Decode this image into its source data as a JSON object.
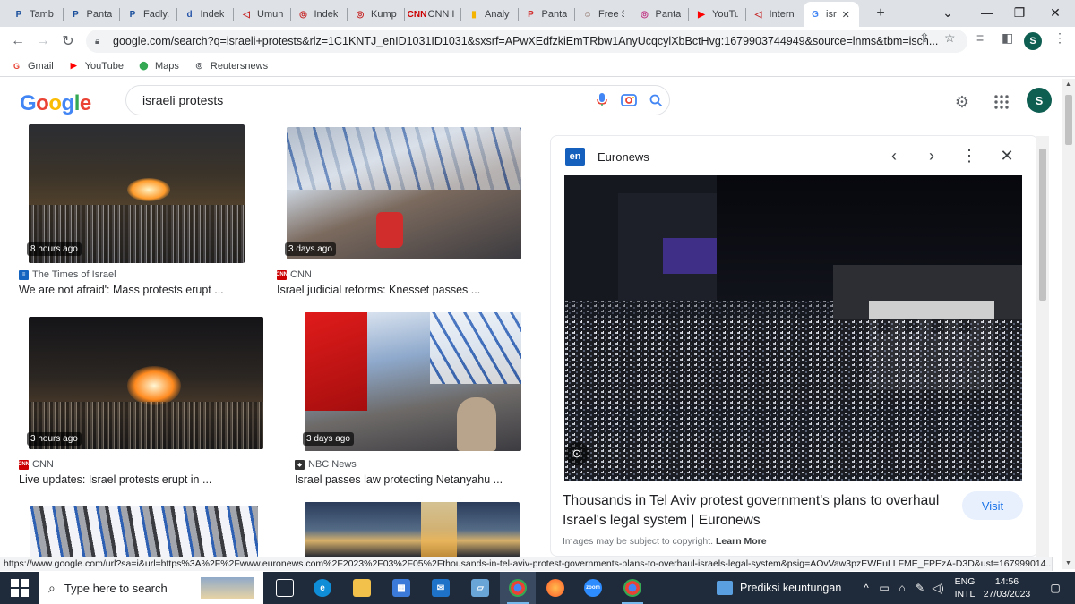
{
  "tabs": [
    {
      "label": "Tamb",
      "icon": "P",
      "color": "#1a4f9c"
    },
    {
      "label": "Panta",
      "icon": "P",
      "color": "#1a4f9c"
    },
    {
      "label": "Fadly.",
      "icon": "P",
      "color": "#1a4f9c"
    },
    {
      "label": "Indek",
      "icon": "d",
      "color": "#2453a8"
    },
    {
      "label": "Umun",
      "icon": "◁",
      "color": "#c62828"
    },
    {
      "label": "Indek",
      "icon": "◎",
      "color": "#c62828"
    },
    {
      "label": "Kump",
      "icon": "◎",
      "color": "#c62828"
    },
    {
      "label": "CNN I",
      "icon": "CNN",
      "color": "#cc0000"
    },
    {
      "label": "Analy",
      "icon": "▮",
      "color": "#f4b400"
    },
    {
      "label": "Panta",
      "icon": "P",
      "color": "#d32f2f"
    },
    {
      "label": "Free S",
      "icon": "☺",
      "color": "#8d6e63"
    },
    {
      "label": "Panta",
      "icon": "◎",
      "color": "#c13584"
    },
    {
      "label": "YouTu",
      "icon": "▶",
      "color": "#ff0000"
    },
    {
      "label": "Intern",
      "icon": "◁",
      "color": "#c62828"
    },
    {
      "label": "isr",
      "icon": "G",
      "color": "#4285f4"
    }
  ],
  "window": {
    "new_tab": "+",
    "dropdown": "⌄",
    "minimize": "—",
    "restore": "❐",
    "close": "✕"
  },
  "omnibox": {
    "url": "google.com/search?q=israeli+protests&rlz=1C1KNTJ_enID1031ID1031&sxsrf=APwXEdfzkiEmTRbw1AnyUcqcylXbBctHvg:1679903744949&source=lnms&tbm=isch...",
    "profile_initial": "S"
  },
  "bookmarks": [
    {
      "label": "Gmail",
      "icon": "G",
      "color": "#ea4335"
    },
    {
      "label": "YouTube",
      "icon": "▶",
      "color": "#ff0000"
    },
    {
      "label": "Maps",
      "icon": "⬤",
      "color": "#34a853"
    },
    {
      "label": "Reutersnews",
      "icon": "◎",
      "color": "#5f6368"
    }
  ],
  "google": {
    "logo": [
      "G",
      "o",
      "o",
      "g",
      "l",
      "e"
    ],
    "logo_colors": [
      "#4285f4",
      "#ea4335",
      "#fbbc05",
      "#4285f4",
      "#34a853",
      "#ea4335"
    ],
    "query": "israeli protests",
    "profile_initial": "S"
  },
  "results": [
    {
      "time": "8 hours ago",
      "source": "The Times of Israel",
      "source_color": "#1565c0",
      "title": "We are not afraid': Mass protests erupt ..."
    },
    {
      "time": "3 days ago",
      "source": "CNN",
      "source_color": "#cc0000",
      "title": "Israel judicial reforms: Knesset passes ..."
    },
    {
      "time": "3 hours ago",
      "source": "CNN",
      "source_color": "#cc0000",
      "title": "Live updates: Israel protests erupt in ..."
    },
    {
      "time": "3 days ago",
      "source": "NBC News",
      "source_color": "#333333",
      "title": "Israel passes law protecting Netanyahu ..."
    }
  ],
  "panel": {
    "badge": "en",
    "site": "Euronews",
    "title": "Thousands in Tel Aviv protest government's plans to overhaul Israel's legal system | Euronews",
    "visit": "Visit",
    "copyright": "Images may be subject to copyright.",
    "learn_more": "Learn More"
  },
  "status_url": "https://www.google.com/url?sa=i&url=https%3A%2F%2Fwww.euronews.com%2F2023%2F03%2F05%2Fthousands-in-tel-aviv-protest-governments-plans-to-overhaul-israels-legal-system&psig=AOvVaw3pzEWEuLLFME_FPEzA-D3D&ust=167999014...",
  "taskbar": {
    "search_placeholder": "Type here to search",
    "widget_text": "Prediksi keuntungan",
    "lang_top": "ENG",
    "lang_bottom": "INTL",
    "time": "14:56",
    "date": "27/03/2023"
  }
}
